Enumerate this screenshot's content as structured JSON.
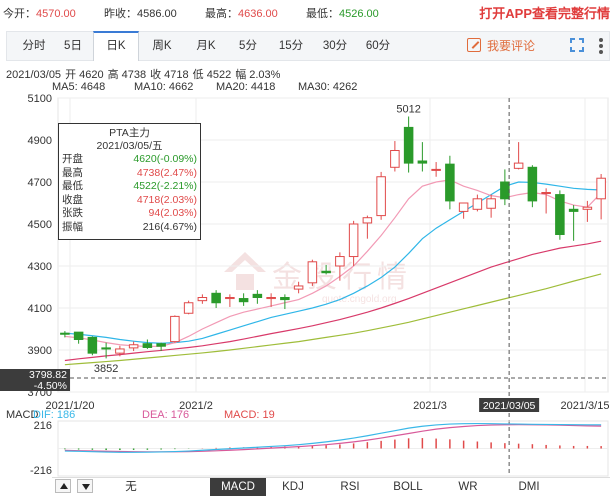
{
  "quote": {
    "open_label": "今开：",
    "open_value": "4570.00",
    "prev_close_label": "昨收：",
    "prev_close_value": "4586.00",
    "high_label": "最高：",
    "high_value": "4636.00",
    "low_label": "最低：",
    "low_value": "4526.00",
    "promo": "打开APP查看完整行情"
  },
  "tabs": [
    "分时",
    "5日",
    "日K",
    "周K",
    "月K",
    "5分",
    "15分",
    "30分",
    "60分"
  ],
  "active_tab": "日K",
  "comment_button": "我要评论",
  "icons": {
    "comment": "pen-square-icon",
    "fullscreen": "expand-icon",
    "menu": "more-vertical-icon"
  },
  "ohlc_line": {
    "date": "2021/03/05",
    "open": "开 4620",
    "high": "高 4738",
    "close": "收 4718",
    "low": "低 4522",
    "amplitude": "幅 2.03%"
  },
  "ma_legend": [
    {
      "label": "MA5: 4648",
      "color": "#f29ab5"
    },
    {
      "label": "MA10: 4662",
      "color": "#2fb6e8"
    },
    {
      "label": "MA20: 4418",
      "color": "#d83a6a"
    },
    {
      "label": "MA30: 4262",
      "color": "#9fbd3a"
    }
  ],
  "tooltip": {
    "title": "PTA主力",
    "date": "2021/03/05/五",
    "rows": [
      {
        "k": "开盘",
        "v": "4620(-0.09%)",
        "c": "green"
      },
      {
        "k": "最高",
        "v": "4738(2.47%)",
        "c": "red"
      },
      {
        "k": "最低",
        "v": "4522(-2.21%)",
        "c": "green"
      },
      {
        "k": "收盘",
        "v": "4718(2.03%)",
        "c": "red"
      },
      {
        "k": "张跌",
        "v": "94(2.03%)",
        "c": "red"
      },
      {
        "k": "振幅",
        "v": "216(4.67%)",
        "c": "dark"
      }
    ]
  },
  "crosshair": {
    "price_label": "3798.82",
    "pct_label": "-4.50%",
    "date_label": "2021/03/05"
  },
  "watermark": {
    "text": "金投行情",
    "url": "quote.cngold.org",
    "logo": "cngold-logo-icon"
  },
  "macd": {
    "name": "MACD",
    "dif_label": "DIF: 186",
    "dea_label": "DEA: 176",
    "macd_label": "MACD: 19",
    "dif_color": "#3ab8e8",
    "dea_color": "#d85a9a",
    "macd_color": "#e04a4a",
    "y_top_label": "216",
    "y_bottom_label": "-216"
  },
  "indicator_tabs": [
    "无",
    "MACD",
    "KDJ",
    "RSI",
    "BOLL",
    "WR",
    "DMI"
  ],
  "active_indicator": "MACD",
  "colors": {
    "up": "#e04a4a",
    "down": "#2a9a2a",
    "grid": "#eeeeee",
    "axis_text": "#333333"
  },
  "chart_data": {
    "type": "candlestick",
    "y_ticks": [
      5100,
      4900,
      4700,
      4500,
      4300,
      4100,
      3900,
      3700
    ],
    "ylim": [
      3700,
      5100
    ],
    "x_labels": [
      "2021/1/20",
      "2021/2",
      "2021/3",
      "2021/3/15"
    ],
    "annotations": [
      {
        "text": "5012",
        "value": 5012
      },
      {
        "text": "3852",
        "value": 3852
      }
    ],
    "candles": [
      [
        3980,
        3990,
        3960,
        3975
      ],
      [
        3985,
        3985,
        3930,
        3950
      ],
      [
        3960,
        3965,
        3875,
        3885
      ],
      [
        3910,
        3935,
        3860,
        3905
      ],
      [
        3885,
        3920,
        3870,
        3905
      ],
      [
        3910,
        3940,
        3895,
        3925
      ],
      [
        3930,
        3950,
        3905,
        3912
      ],
      [
        3930,
        3935,
        3895,
        3918
      ],
      [
        3940,
        4065,
        3935,
        4060
      ],
      [
        4075,
        4135,
        4070,
        4125
      ],
      [
        4135,
        4165,
        4120,
        4150
      ],
      [
        4170,
        4185,
        4100,
        4125
      ],
      [
        4145,
        4165,
        4105,
        4150
      ],
      [
        4145,
        4170,
        4110,
        4130
      ],
      [
        4165,
        4185,
        4120,
        4150
      ],
      [
        4145,
        4170,
        4105,
        4150
      ],
      [
        4150,
        4165,
        4095,
        4140
      ],
      [
        4190,
        4225,
        4170,
        4205
      ],
      [
        4220,
        4330,
        4205,
        4320
      ],
      [
        4275,
        4305,
        4260,
        4268
      ],
      [
        4300,
        4365,
        4230,
        4345
      ],
      [
        4345,
        4515,
        4300,
        4500
      ],
      [
        4505,
        4540,
        4430,
        4530
      ],
      [
        4540,
        4748,
        4520,
        4725
      ],
      [
        4770,
        4895,
        4750,
        4850
      ],
      [
        4960,
        5012,
        4745,
        4790
      ],
      [
        4800,
        4890,
        4750,
        4790
      ],
      [
        4760,
        4795,
        4725,
        4760
      ],
      [
        4785,
        4825,
        4570,
        4610
      ],
      [
        4560,
        4600,
        4525,
        4600
      ],
      [
        4570,
        4640,
        4560,
        4620
      ],
      [
        4575,
        4640,
        4530,
        4620
      ],
      [
        4700,
        4760,
        4590,
        4620
      ],
      [
        4765,
        4890,
        4760,
        4790
      ],
      [
        4770,
        4780,
        4580,
        4610
      ],
      [
        4650,
        4670,
        4550,
        4650
      ],
      [
        4640,
        4660,
        4425,
        4450
      ],
      [
        4570,
        4590,
        4420,
        4560
      ],
      [
        4570,
        4610,
        4510,
        4580
      ],
      [
        4620,
        4738,
        4522,
        4718
      ]
    ],
    "ma5": [
      3965,
      3958,
      3948,
      3935,
      3925,
      3920,
      3917,
      3918,
      3935,
      3965,
      4000,
      4030,
      4060,
      4080,
      4095,
      4110,
      4125,
      4140,
      4170,
      4205,
      4250,
      4300,
      4370,
      4445,
      4530,
      4620,
      4680,
      4700,
      4710,
      4680,
      4660,
      4635,
      4625,
      4640,
      4650,
      4640,
      4610,
      4590,
      4580,
      4648
    ],
    "ma10": [
      3980,
      3975,
      3968,
      3960,
      3950,
      3942,
      3935,
      3932,
      3935,
      3942,
      3955,
      3975,
      3995,
      4015,
      4035,
      4055,
      4070,
      4085,
      4100,
      4118,
      4140,
      4170,
      4205,
      4245,
      4295,
      4360,
      4430,
      4480,
      4520,
      4560,
      4600,
      4640,
      4680,
      4700,
      4698,
      4690,
      4680,
      4670,
      4665,
      4662
    ],
    "ma20": [
      3850,
      3858,
      3865,
      3872,
      3878,
      3885,
      3892,
      3898,
      3905,
      3912,
      3920,
      3930,
      3940,
      3952,
      3965,
      3978,
      3990,
      4002,
      4015,
      4030,
      4045,
      4062,
      4080,
      4100,
      4122,
      4145,
      4170,
      4195,
      4220,
      4245,
      4270,
      4295,
      4315,
      4335,
      4355,
      4370,
      4385,
      4395,
      4405,
      4418
    ],
    "ma30": [
      3830,
      3835,
      3840,
      3845,
      3850,
      3856,
      3862,
      3868,
      3874,
      3880,
      3886,
      3893,
      3900,
      3908,
      3916,
      3924,
      3932,
      3940,
      3950,
      3960,
      3970,
      3980,
      3992,
      4005,
      4018,
      4032,
      4048,
      4064,
      4080,
      4096,
      4112,
      4128,
      4144,
      4160,
      4176,
      4192,
      4210,
      4228,
      4245,
      4262
    ],
    "macd_hist": [
      -6,
      -8,
      -10,
      -12,
      -12,
      -11,
      -10,
      -8,
      -5,
      -2,
      2,
      5,
      8,
      10,
      12,
      14,
      16,
      18,
      22,
      26,
      32,
      40,
      50,
      60,
      70,
      80,
      82,
      78,
      72,
      62,
      55,
      48,
      42,
      38,
      34,
      28,
      24,
      20,
      20,
      19
    ],
    "dif": [
      -20,
      -22,
      -25,
      -28,
      -30,
      -30,
      -29,
      -27,
      -24,
      -20,
      -14,
      -8,
      -2,
      4,
      10,
      16,
      22,
      30,
      40,
      52,
      66,
      82,
      100,
      120,
      140,
      160,
      175,
      185,
      192,
      195,
      196,
      195,
      193,
      192,
      190,
      189,
      188,
      187,
      186,
      186
    ],
    "dea": [
      -15,
      -17,
      -19,
      -21,
      -23,
      -25,
      -26,
      -26,
      -26,
      -25,
      -22,
      -18,
      -14,
      -9,
      -3,
      3,
      9,
      15,
      22,
      30,
      40,
      52,
      66,
      82,
      100,
      118,
      136,
      152,
      164,
      173,
      180,
      184,
      186,
      187,
      186,
      185,
      183,
      180,
      178,
      176
    ],
    "macd_ylim": [
      -216,
      216
    ]
  }
}
